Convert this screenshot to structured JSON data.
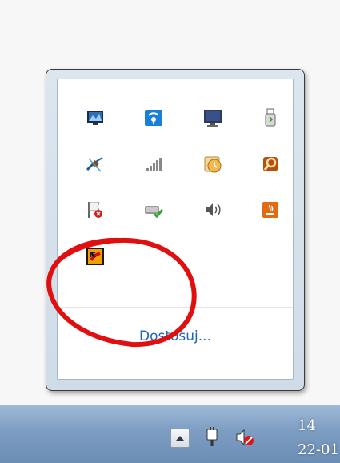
{
  "tray_popup": {
    "customize_label": "Dostosuj...",
    "icons": [
      {
        "name": "network-monitor-icon"
      },
      {
        "name": "wifi-signal-icon"
      },
      {
        "name": "display-icon"
      },
      {
        "name": "usb-device-icon"
      },
      {
        "name": "satellite-icon"
      },
      {
        "name": "signal-bars-icon"
      },
      {
        "name": "scheduler-clock-icon"
      },
      {
        "name": "search-magnifier-icon"
      },
      {
        "name": "action-center-flag-icon"
      },
      {
        "name": "network-check-icon"
      },
      {
        "name": "volume-icon"
      },
      {
        "name": "java-icon"
      },
      {
        "name": "flash-shortcut-icon"
      }
    ]
  },
  "annotation": {
    "color": "#e01010"
  },
  "taskbar": {
    "show_hidden_icon": "triangle-up-icon",
    "clock_time": "14",
    "clock_date": "22-01"
  },
  "colors": {
    "link": "#1f66c0",
    "taskbar": "#7d9dc2"
  }
}
